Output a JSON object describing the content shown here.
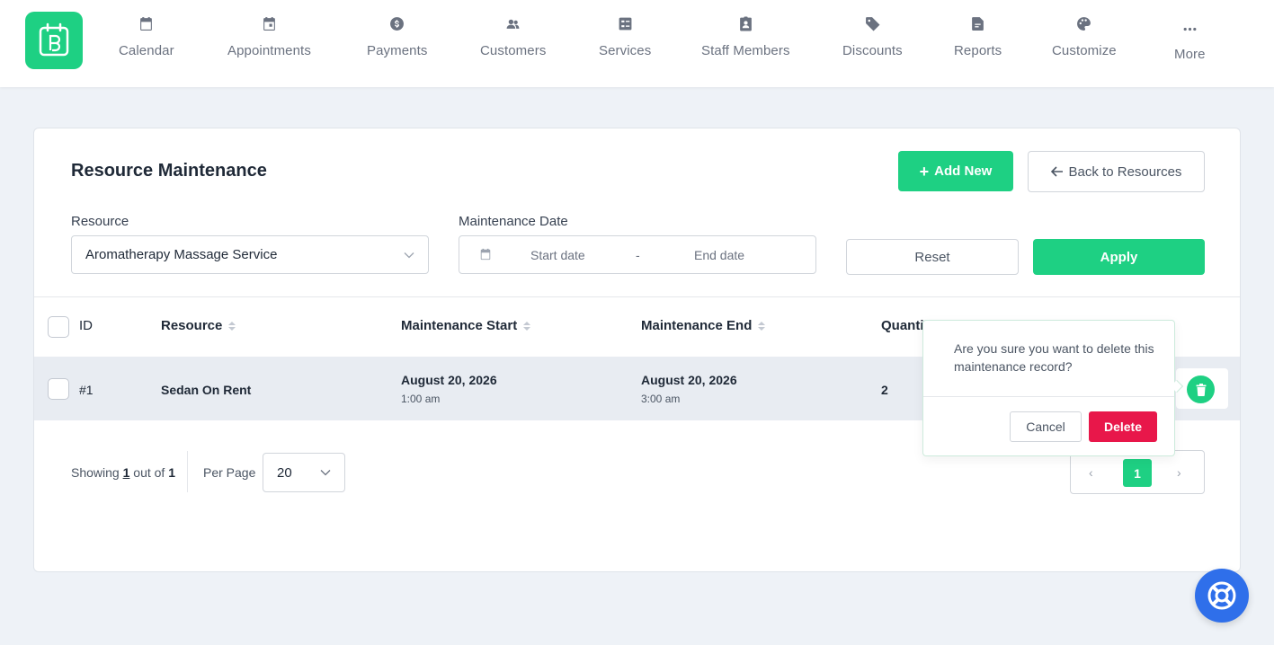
{
  "nav": {
    "items": [
      {
        "label": "Calendar",
        "icon": "calendar-icon"
      },
      {
        "label": "Appointments",
        "icon": "calendar-check-icon"
      },
      {
        "label": "Payments",
        "icon": "dollar-icon"
      },
      {
        "label": "Customers",
        "icon": "users-icon"
      },
      {
        "label": "Services",
        "icon": "list-icon"
      },
      {
        "label": "Staff Members",
        "icon": "id-badge-icon"
      },
      {
        "label": "Discounts",
        "icon": "tag-icon"
      },
      {
        "label": "Reports",
        "icon": "report-icon"
      },
      {
        "label": "Customize",
        "icon": "palette-icon"
      }
    ],
    "more_label": "More"
  },
  "page": {
    "title": "Resource Maintenance",
    "add_new_label": "Add New",
    "back_label": "Back to Resources"
  },
  "filters": {
    "resource_label": "Resource",
    "resource_value": "Aromatherapy Massage Service",
    "date_label": "Maintenance Date",
    "start_placeholder": "Start date",
    "separator": "-",
    "end_placeholder": "End date",
    "reset_label": "Reset",
    "apply_label": "Apply"
  },
  "table": {
    "columns": [
      "ID",
      "Resource",
      "Maintenance Start",
      "Maintenance End",
      "Quanti"
    ],
    "rows": [
      {
        "id": "#1",
        "resource": "Sedan On Rent",
        "start_date": "August 20, 2026",
        "start_time": "1:00 am",
        "end_date": "August 20, 2026",
        "end_time": "3:00 am",
        "quantity": "2"
      }
    ]
  },
  "footer": {
    "showing_prefix": "Showing",
    "showing_count": "1",
    "showing_mid": "out of",
    "showing_total": "1",
    "per_page_label": "Per Page",
    "per_page_value": "20",
    "current_page": "1"
  },
  "popconfirm": {
    "message": "Are you sure you want to delete this maintenance record?",
    "cancel_label": "Cancel",
    "delete_label": "Delete"
  },
  "colors": {
    "accent": "#1ed083",
    "danger": "#e8174a",
    "help": "#2f6fea"
  }
}
